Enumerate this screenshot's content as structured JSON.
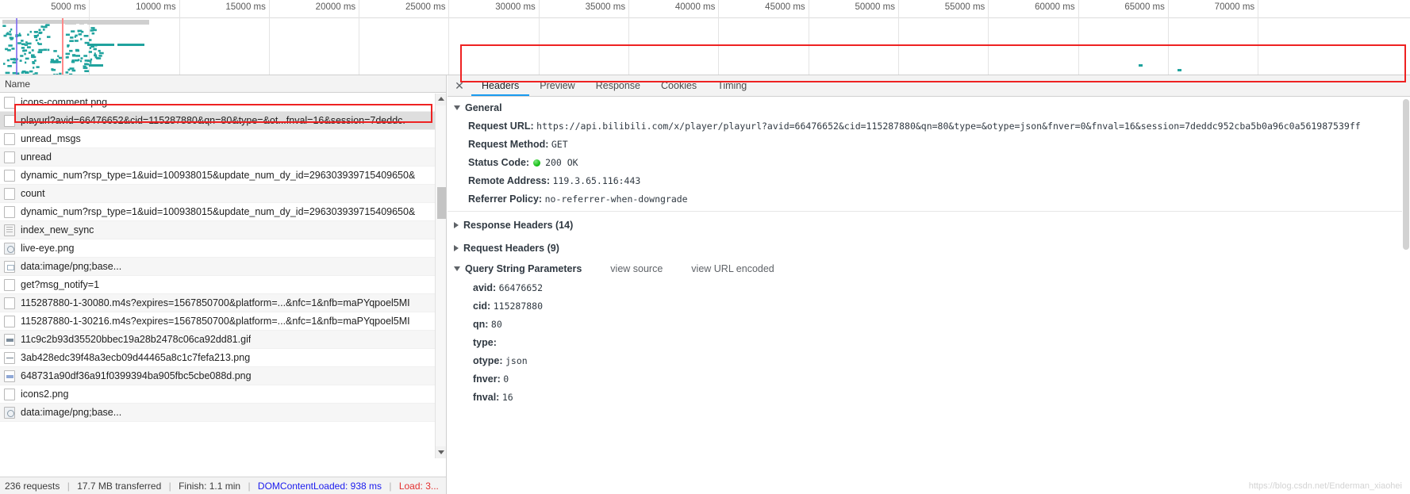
{
  "overview": {
    "ticks": [
      "5000 ms",
      "10000 ms",
      "15000 ms",
      "20000 ms",
      "25000 ms",
      "30000 ms",
      "35000 ms",
      "40000 ms",
      "45000 ms",
      "50000 ms",
      "55000 ms",
      "60000 ms",
      "65000 ms",
      "70000 ms"
    ],
    "dcl_marker_color": "#7b68ee",
    "load_marker_color": "#ff8a8a",
    "bar_color": "#20a39e"
  },
  "left_pane": {
    "column_header": "Name",
    "rows": [
      {
        "name": "icons-comment.png",
        "icon": "file-icon",
        "selected": false
      },
      {
        "name": "playurl?avid=66476652&cid=115287880&qn=80&type=&ot...fnval=16&session=7deddc.",
        "icon": "file-icon",
        "selected": true
      },
      {
        "name": "unread_msgs",
        "icon": "file-icon",
        "selected": false
      },
      {
        "name": "unread",
        "icon": "file-icon",
        "selected": false
      },
      {
        "name": "dynamic_num?rsp_type=1&uid=100938015&update_num_dy_id=296303939715409650&",
        "icon": "file-icon",
        "selected": false
      },
      {
        "name": "count",
        "icon": "file-icon",
        "selected": false
      },
      {
        "name": "dynamic_num?rsp_type=1&uid=100938015&update_num_dy_id=296303939715409650&",
        "icon": "file-icon",
        "selected": false
      },
      {
        "name": "index_new_sync",
        "icon": "document-icon",
        "selected": false
      },
      {
        "name": "live-eye.png",
        "icon": "image-icon",
        "selected": false
      },
      {
        "name": "data:image/png;base...",
        "icon": "image-small-icon",
        "selected": false
      },
      {
        "name": "get?msg_notify=1",
        "icon": "file-icon",
        "selected": false
      },
      {
        "name": "115287880-1-30080.m4s?expires=1567850700&platform=...&nfc=1&nfb=maPYqpoel5MI",
        "icon": "file-icon",
        "selected": false
      },
      {
        "name": "115287880-1-30216.m4s?expires=1567850700&platform=...&nfc=1&nfb=maPYqpoel5MI",
        "icon": "file-icon",
        "selected": false
      },
      {
        "name": "11c9c2b93d35520bbec19a28b2478c06ca92dd81.gif",
        "icon": "gif-icon",
        "selected": false
      },
      {
        "name": "3ab428edc39f48a3ecb09d44465a8c1c7fefa213.png",
        "icon": "dash-image-icon",
        "selected": false
      },
      {
        "name": "648731a90df36a91f0399394ba905fbc5cbe088d.png",
        "icon": "blue-image-icon",
        "selected": false
      },
      {
        "name": "icons2.png",
        "icon": "file-icon",
        "selected": false
      },
      {
        "name": "data:image/png;base...",
        "icon": "image-icon",
        "selected": false
      }
    ]
  },
  "status_bar": {
    "requests": "236 requests",
    "transferred": "17.7 MB transferred",
    "finish": "Finish: 1.1 min",
    "dom_content_loaded": "DOMContentLoaded: 938 ms",
    "load": "Load: 3...",
    "separator": "|"
  },
  "right_pane": {
    "close_label": "✕",
    "tabs": [
      {
        "label": "Headers",
        "active": true
      },
      {
        "label": "Preview",
        "active": false
      },
      {
        "label": "Response",
        "active": false
      },
      {
        "label": "Cookies",
        "active": false
      },
      {
        "label": "Timing",
        "active": false
      }
    ],
    "general": {
      "title": "General",
      "request_url_label": "Request URL:",
      "request_url_value": "https://api.bilibili.com/x/player/playurl?avid=66476652&cid=115287880&qn=80&type=&otype=json&fnver=0&fnval=16&session=7deddc952cba5b0a96c0a561987539ff",
      "request_method_label": "Request Method:",
      "request_method_value": "GET",
      "status_code_label": "Status Code:",
      "status_code_value": "200  OK",
      "remote_address_label": "Remote Address:",
      "remote_address_value": "119.3.65.116:443",
      "referrer_policy_label": "Referrer Policy:",
      "referrer_policy_value": "no-referrer-when-downgrade"
    },
    "response_headers_title": "Response Headers (14)",
    "request_headers_title": "Request Headers (9)",
    "query_string": {
      "title": "Query String Parameters",
      "view_source": "view source",
      "view_url_encoded": "view URL encoded",
      "params": [
        {
          "key": "avid:",
          "value": "66476652"
        },
        {
          "key": "cid:",
          "value": "115287880"
        },
        {
          "key": "qn:",
          "value": "80"
        },
        {
          "key": "type:",
          "value": ""
        },
        {
          "key": "otype:",
          "value": "json"
        },
        {
          "key": "fnver:",
          "value": "0"
        },
        {
          "key": "fnval:",
          "value": "16"
        }
      ]
    }
  },
  "watermark": "https://blog.csdn.net/Enderman_xiaohei"
}
